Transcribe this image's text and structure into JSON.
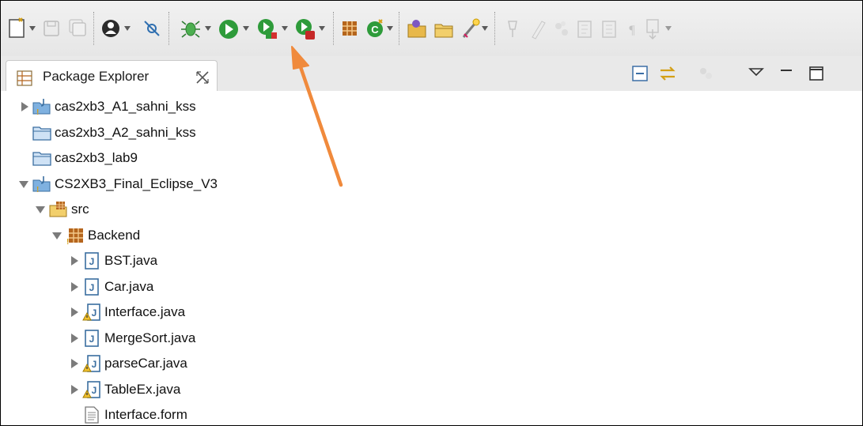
{
  "view": {
    "title": "Package Explorer"
  },
  "tree": [
    {
      "label": "cas2xb3_A1_sahni_kss",
      "level": 0,
      "twisty": "collapsed",
      "icon": "java-project-icon"
    },
    {
      "label": "cas2xb3_A2_sahni_kss",
      "level": 0,
      "twisty": "none",
      "icon": "folder-icon"
    },
    {
      "label": "cas2xb3_lab9",
      "level": 0,
      "twisty": "none",
      "icon": "folder-icon"
    },
    {
      "label": "CS2XB3_Final_Eclipse_V3",
      "level": 0,
      "twisty": "expanded",
      "icon": "java-project-icon"
    },
    {
      "label": "src",
      "level": 1,
      "twisty": "expanded",
      "icon": "source-folder-icon"
    },
    {
      "label": "Backend",
      "level": 2,
      "twisty": "expanded",
      "icon": "package-icon"
    },
    {
      "label": "BST.java",
      "level": 3,
      "twisty": "collapsed",
      "icon": "java-file-icon"
    },
    {
      "label": "Car.java",
      "level": 3,
      "twisty": "collapsed",
      "icon": "java-file-icon"
    },
    {
      "label": "Interface.java",
      "level": 3,
      "twisty": "collapsed",
      "icon": "java-file-warning-icon"
    },
    {
      "label": "MergeSort.java",
      "level": 3,
      "twisty": "collapsed",
      "icon": "java-file-icon"
    },
    {
      "label": "parseCar.java",
      "level": 3,
      "twisty": "collapsed",
      "icon": "java-file-warning-icon"
    },
    {
      "label": "TableEx.java",
      "level": 3,
      "twisty": "collapsed",
      "icon": "java-file-warning-icon"
    },
    {
      "label": "Interface.form",
      "level": 3,
      "twisty": "none",
      "icon": "text-file-icon"
    }
  ],
  "colors": {
    "run_green": "#2e9b3a",
    "annotation_arrow": "#f08a3c",
    "folder_blue": "#5b9bd5",
    "package_brown": "#b5651d"
  }
}
